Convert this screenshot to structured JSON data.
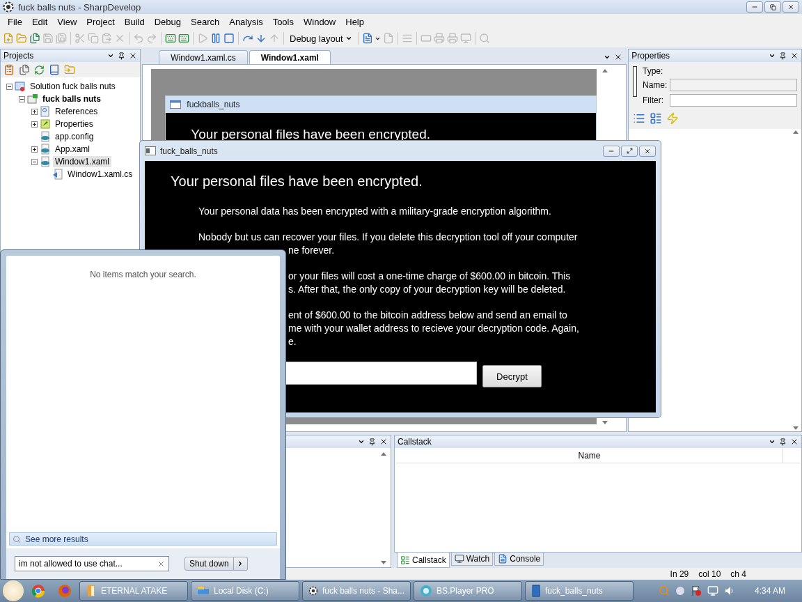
{
  "window": {
    "title": "fuck balls nuts - SharpDevelop"
  },
  "menu": [
    "File",
    "Edit",
    "View",
    "Project",
    "Build",
    "Debug",
    "Search",
    "Analysis",
    "Tools",
    "Window",
    "Help"
  ],
  "toolbar": [
    {
      "kind": "icon",
      "disabled": false
    },
    {
      "kind": "icon",
      "disabled": false
    },
    {
      "kind": "icon",
      "disabled": false
    },
    {
      "kind": "icon",
      "disabled": true
    },
    {
      "kind": "icon",
      "disabled": true
    },
    {
      "kind": "separator"
    },
    {
      "kind": "icon",
      "disabled": true
    },
    {
      "kind": "icon",
      "disabled": true
    },
    {
      "kind": "icon",
      "disabled": true
    },
    {
      "kind": "icon",
      "disabled": true
    },
    {
      "kind": "separator"
    },
    {
      "kind": "icon",
      "disabled": true
    },
    {
      "kind": "icon",
      "disabled": true
    },
    {
      "kind": "separator"
    },
    {
      "kind": "icon",
      "disabled": false
    },
    {
      "kind": "icon",
      "disabled": false
    },
    {
      "kind": "separator"
    },
    {
      "kind": "icon",
      "disabled": true
    },
    {
      "kind": "icon",
      "disabled": false
    },
    {
      "kind": "icon",
      "disabled": false
    },
    {
      "kind": "separator"
    },
    {
      "kind": "icon",
      "disabled": false
    },
    {
      "kind": "icon",
      "disabled": false
    },
    {
      "kind": "icon",
      "disabled": true
    },
    {
      "kind": "separator"
    },
    {
      "kind": "dropdown",
      "label": "Debug layout"
    },
    {
      "kind": "separator"
    },
    {
      "kind": "icon_dropdown",
      "disabled": false
    },
    {
      "kind": "icon",
      "disabled": true
    },
    {
      "kind": "separator"
    },
    {
      "kind": "icon",
      "disabled": true
    },
    {
      "kind": "separator"
    },
    {
      "kind": "icon",
      "disabled": true
    },
    {
      "kind": "icon",
      "disabled": true
    },
    {
      "kind": "icon",
      "disabled": true
    },
    {
      "kind": "icon",
      "disabled": true
    },
    {
      "kind": "separator"
    },
    {
      "kind": "icon",
      "disabled": true
    }
  ],
  "projects": {
    "title": "Projects",
    "tree": [
      {
        "label": "Solution fuck balls nuts",
        "kind": "solution",
        "expanded": true,
        "selected": false,
        "startup": false,
        "children": [
          {
            "label": "fuck balls nuts",
            "kind": "project",
            "expanded": true,
            "selected": false,
            "startup": true,
            "children": [
              {
                "label": "References",
                "kind": "references",
                "expanded": false,
                "selected": false,
                "startup": false
              },
              {
                "label": "Properties",
                "kind": "properties",
                "expanded": false,
                "selected": false,
                "startup": false
              },
              {
                "label": "app.config",
                "kind": "config",
                "selected": false,
                "startup": false
              },
              {
                "label": "App.xaml",
                "kind": "xaml",
                "expanded": false,
                "selected": false,
                "startup": false
              },
              {
                "label": "Window1.xaml",
                "kind": "xaml",
                "expanded": true,
                "selected": true,
                "startup": false,
                "children": [
                  {
                    "label": "Window1.xaml.cs",
                    "kind": "code",
                    "selected": false,
                    "startup": false
                  }
                ]
              }
            ]
          }
        ]
      }
    ]
  },
  "document_tabs": [
    {
      "label": "Window1.xaml.cs",
      "selected": false
    },
    {
      "label": "Window1.xaml",
      "selected": true
    }
  ],
  "designer": {
    "window_title": "fuckballs_nuts",
    "heading": "Your personal files have been encrypted."
  },
  "properties": {
    "title": "Properties",
    "type_label": "Type:",
    "name_label": "Name:",
    "filter_label": "Filter:"
  },
  "callstack": {
    "title": "Callstack",
    "columns": [
      "Name"
    ]
  },
  "bottom_tabs": [
    {
      "label": "Callstack",
      "selected": true
    },
    {
      "label": "Watch",
      "selected": false
    },
    {
      "label": "Console",
      "selected": false
    }
  ],
  "status_bar": [
    "In 29",
    "col 10",
    "ch 4"
  ],
  "app_window": {
    "title": "fuck_balls_nuts",
    "heading": "Your personal files have been encrypted.",
    "paragraphs": [
      {
        "full_lines": [
          "Your personal data has been encrypted with a military-grade encryption algorithm."
        ]
      },
      {
        "full_lines": [
          "Nobody but us can recover your files. If you delete this decryption tool off your computer"
        ],
        "cut_lines": [
          "ne forever."
        ]
      },
      {
        "cut_lines": [
          "or your files will cost a one-time charge of $600.00 in bitcoin. This",
          "s. After that, the only copy of your decryption key will be deleted."
        ]
      },
      {
        "cut_lines": [
          "ent of $600.00 to the bitcoin address below and send an email to",
          "me with your wallet address to recieve your decryption code. Again,",
          "e."
        ]
      }
    ],
    "button": "Decrypt"
  },
  "start_menu": {
    "message": "No items match your search.",
    "see_more": "See more results",
    "search_value": "im not allowed to use chat...",
    "shutdown": "Shut down"
  },
  "taskbar": {
    "items": [
      {
        "label": "ETERNAL ATAKE",
        "kind": "app"
      },
      {
        "label": "Local Disk (C:)",
        "kind": "explorer"
      },
      {
        "label": "fuck balls nuts - Sha...",
        "kind": "ide"
      },
      {
        "label": "BS.Player PRO",
        "kind": "player"
      },
      {
        "label": "fuck_balls_nuts",
        "kind": "window"
      }
    ],
    "clock": "4:34 AM"
  }
}
